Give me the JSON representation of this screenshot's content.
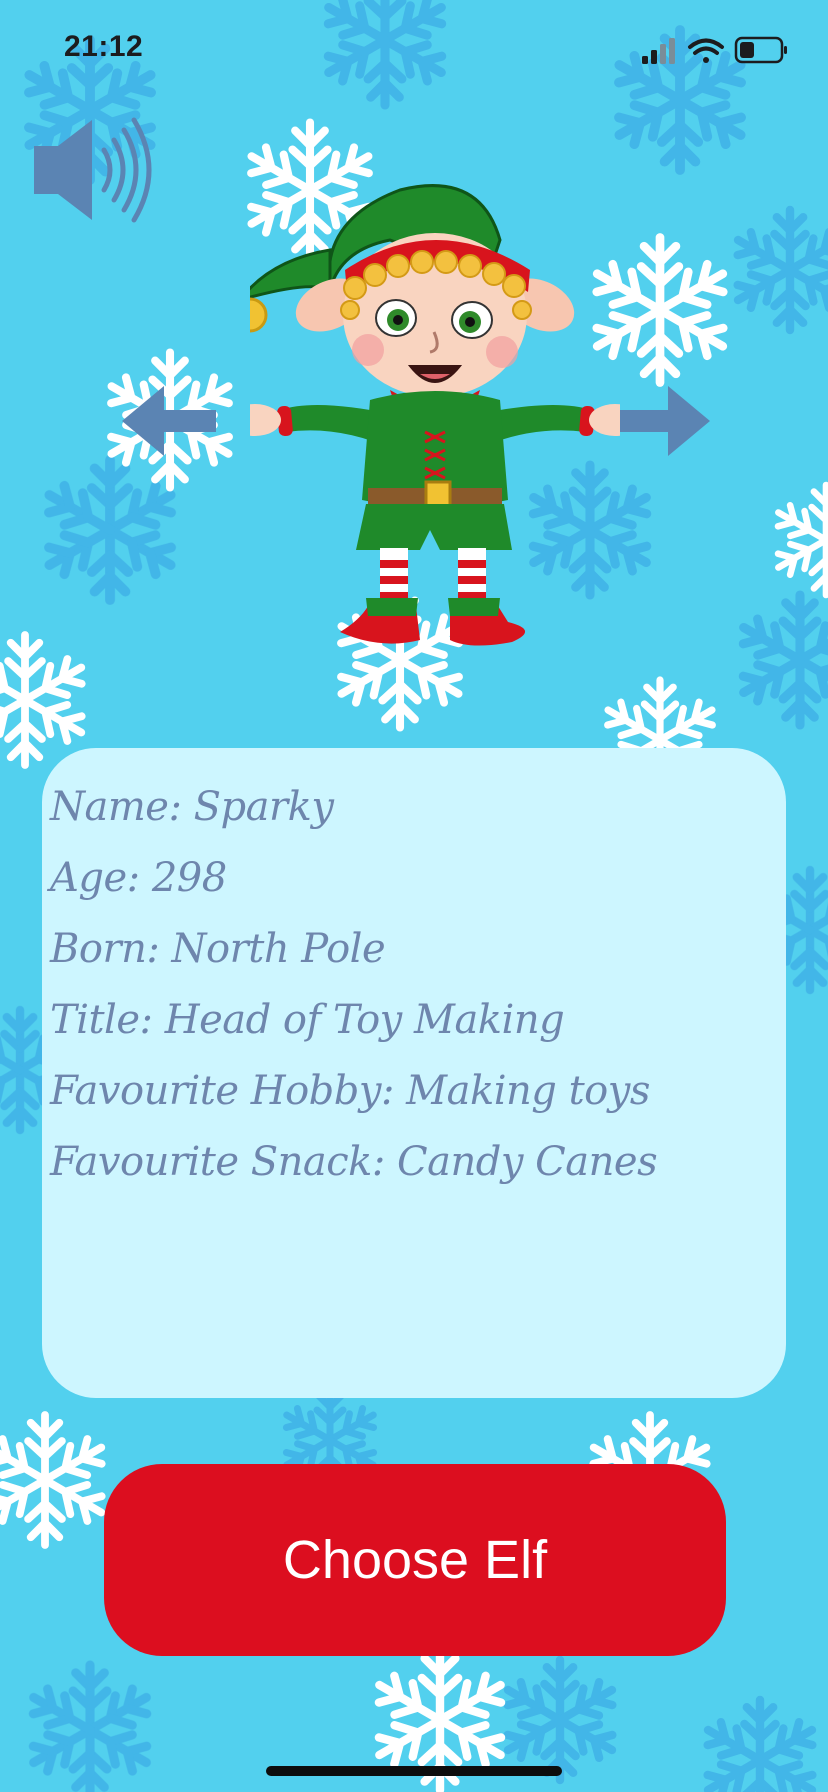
{
  "status_bar": {
    "time": "21:12",
    "icons": [
      "cellular-signal-icon",
      "wifi-icon",
      "battery-icon"
    ]
  },
  "controls": {
    "sound_icon": "speaker-icon",
    "prev_icon": "arrow-left-icon",
    "next_icon": "arrow-right-icon"
  },
  "elf": {
    "info": [
      "Name: Sparky",
      "Age: 298",
      "Born: North Pole",
      "Title: Head of Toy Making",
      "Favourite Hobby: Making toys",
      "Favourite Snack: Candy Canes"
    ]
  },
  "choose_button": {
    "label": "Choose Elf"
  },
  "colors": {
    "background": "#52d0ee",
    "card": "#cdf6ff",
    "card_text": "#6e86ad",
    "button": "#dc0e1f",
    "arrow": "#5b84b3"
  }
}
